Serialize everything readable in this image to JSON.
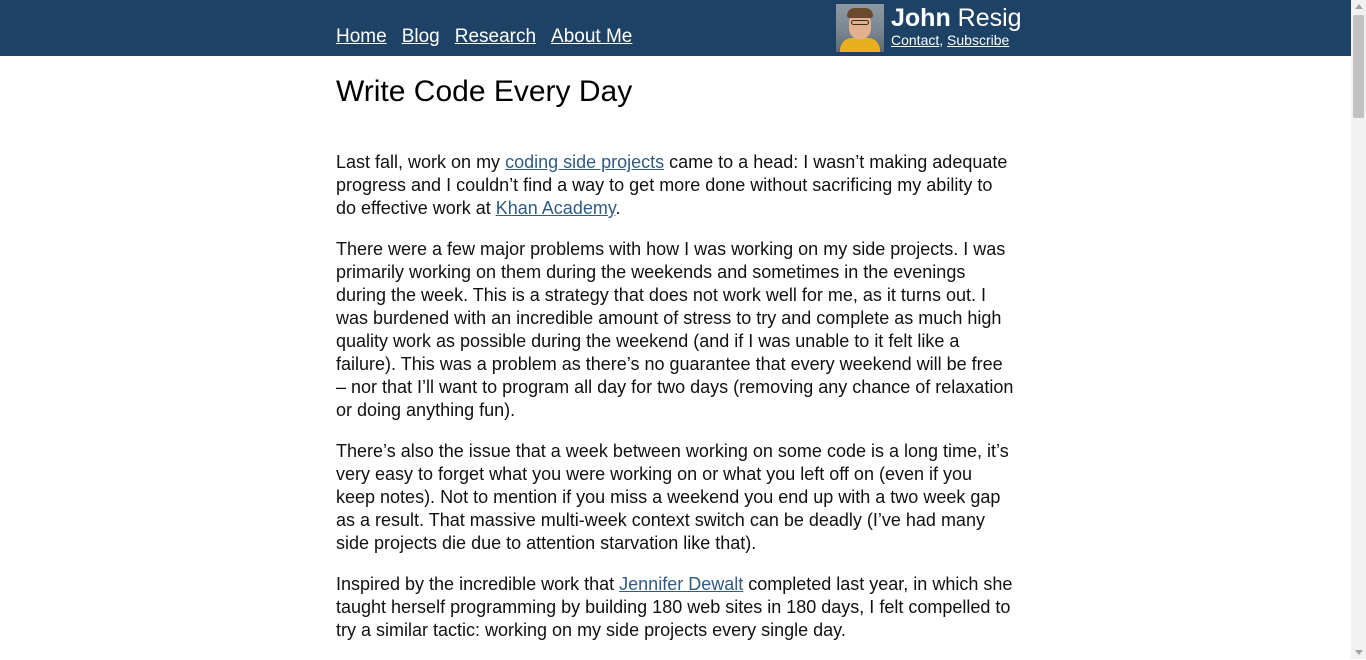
{
  "nav": {
    "items": [
      "Home",
      "Blog",
      "Research",
      "About Me"
    ]
  },
  "brand": {
    "first_name": "John",
    "last_name": "Resig",
    "contact_label": "Contact",
    "separator": ",",
    "subscribe_label": "Subscribe",
    "avatar_icon": "author-photo"
  },
  "post": {
    "title": "Write Code Every Day",
    "p1": {
      "t1": "Last fall, work on my ",
      "link1": "coding side projects",
      "t2": " came to a head: I wasn’t making adequate progress and I couldn’t find a way to get more done without sacrificing my ability to do effective work at ",
      "link2": "Khan Academy",
      "t3": "."
    },
    "p2": "There were a few major problems with how I was working on my side projects. I was primarily working on them during the weekends and sometimes in the evenings during the week. This is a strategy that does not work well for me, as it turns out. I was burdened with an incredible amount of stress to try and complete as much high quality work as possible during the weekend (and if I was unable to it felt like a failure). This was a problem as there’s no guarantee that every weekend will be free – nor that I’ll want to program all day for two days (removing any chance of relaxation or doing anything fun).",
    "p3": "There’s also the issue that a week between working on some code is a long time, it’s very easy to forget what you were working on or what you left off on (even if you keep notes). Not to mention if you miss a weekend you end up with a two week gap as a result. That massive multi-week context switch can be deadly (I’ve had many side projects die due to attention starvation like that).",
    "p4": {
      "t1": "Inspired by the incredible work that ",
      "link1": "Jennifer Dewalt",
      "t2": " completed last year, in which she taught herself programming by building 180 web sites in 180 days, I felt compelled to try a similar tactic: working on my side projects every single day."
    }
  },
  "colors": {
    "header_bg": "#1e4265",
    "link": "#2f5b86"
  }
}
